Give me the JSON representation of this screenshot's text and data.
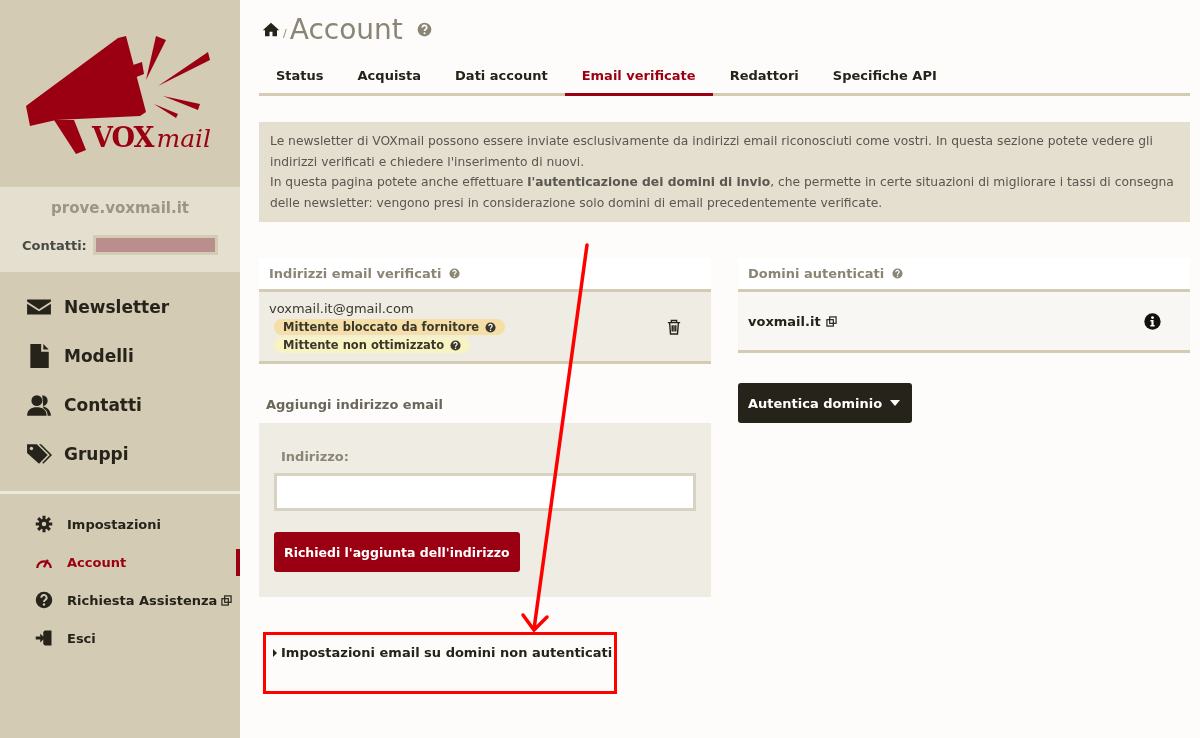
{
  "logo": {
    "brand": "VOX",
    "suffix": "mail"
  },
  "site": {
    "name": "prove.voxmail.it",
    "contacts_label": "Contatti:"
  },
  "main_nav": [
    {
      "label": "Newsletter",
      "kind": "envelope"
    },
    {
      "label": "Modelli",
      "kind": "file"
    },
    {
      "label": "Contatti",
      "kind": "users"
    },
    {
      "label": "Gruppi",
      "kind": "tags"
    }
  ],
  "secondary_nav": [
    {
      "label": "Impostazioni",
      "kind": "gear",
      "selected": false,
      "external": false
    },
    {
      "label": "Account",
      "kind": "gauge",
      "selected": true,
      "external": false
    },
    {
      "label": "Richiesta Assistenza",
      "kind": "help",
      "selected": false,
      "external": true
    },
    {
      "label": "Esci",
      "kind": "exit",
      "selected": false,
      "external": false
    }
  ],
  "page": {
    "breadcrumb_separator": "/",
    "title": "Account"
  },
  "tabs": [
    {
      "label": "Status",
      "selected": false
    },
    {
      "label": "Acquista",
      "selected": false
    },
    {
      "label": "Dati account",
      "selected": false
    },
    {
      "label": "Email verificate",
      "selected": true
    },
    {
      "label": "Redattori",
      "selected": false
    },
    {
      "label": "Specifiche API",
      "selected": false
    }
  ],
  "info": [
    "Le newsletter di VOXmail possono essere inviate esclusivamente da indirizzi email riconosciuti come vostri. In questa sezione potete vedere gli indirizzi verificati e chiedere l'inserimento di nuovi.",
    "In questa pagina potete anche effettuare **l'autenticazione dei domini di invio**, che permette in certe situazioni di migliorare i tassi di consegna delle newsletter: vengono presi in considerazione solo domini di email precedentemente verificate."
  ],
  "verified_emails": {
    "title": "Indirizzi email verificati",
    "items": [
      {
        "email": "voxmail.it@gmail.com",
        "tags": [
          {
            "label": "Mittente bloccato da fornitore",
            "color": "#f6dfa6"
          },
          {
            "label": "Mittente non ottimizzato",
            "color": "#f8f3c2"
          }
        ]
      }
    ]
  },
  "add_email": {
    "title": "Aggiungi indirizzo email",
    "label": "Indirizzo:",
    "button": "Richiedi l'aggiunta dell'indirizzo"
  },
  "domains": {
    "title": "Domini autenticati",
    "items": [
      {
        "domain": "voxmail.it",
        "external": true
      }
    ],
    "button": "Autentica dominio"
  },
  "expander": {
    "label": "Impostazioni email su domini non autenticati",
    "expanded": false
  }
}
